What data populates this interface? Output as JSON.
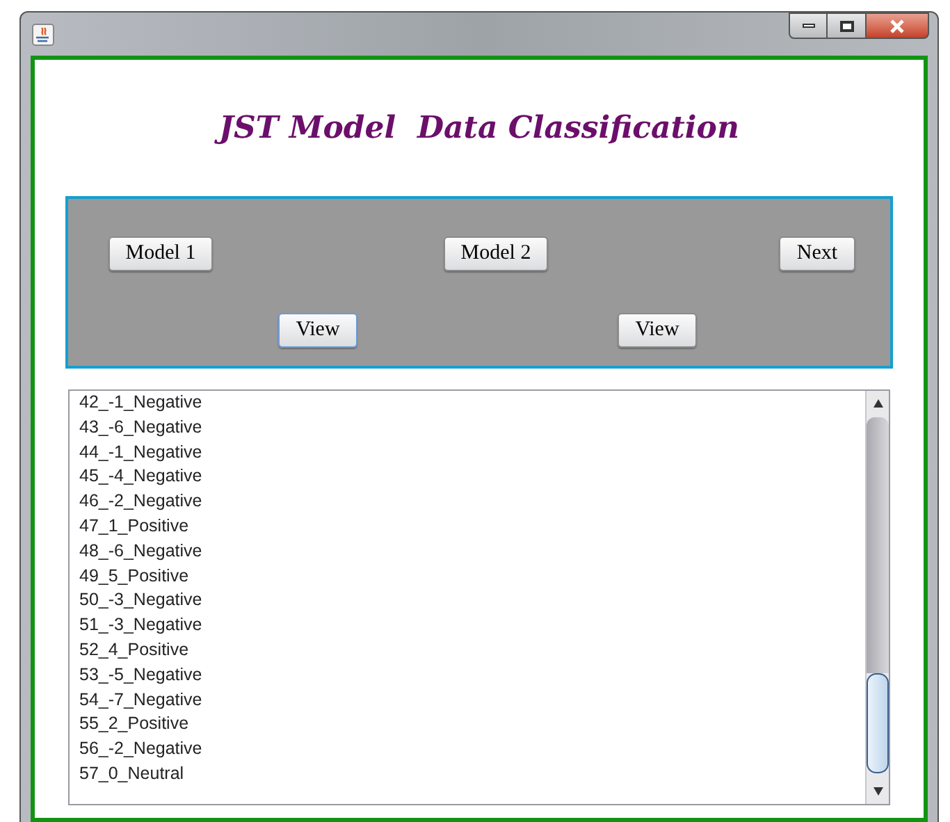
{
  "heading": "JST Model  Data Classification",
  "top_buttons": [
    {
      "label": "Model 1"
    },
    {
      "label": "Model 2"
    },
    {
      "label": "Next"
    }
  ],
  "view_buttons": [
    {
      "label": "View",
      "focused": true
    },
    {
      "label": "View",
      "focused": false
    }
  ],
  "results": [
    "42_-1_Negative",
    "43_-6_Negative",
    "44_-1_Negative",
    "45_-4_Negative",
    "46_-2_Negative",
    "47_1_Positive",
    "48_-6_Negative",
    "49_5_Positive",
    "50_-3_Negative",
    "51_-3_Negative",
    "52_4_Positive",
    "53_-5_Negative",
    "54_-7_Negative",
    "55_2_Positive",
    "56_-2_Negative",
    "57_0_Neutral"
  ]
}
